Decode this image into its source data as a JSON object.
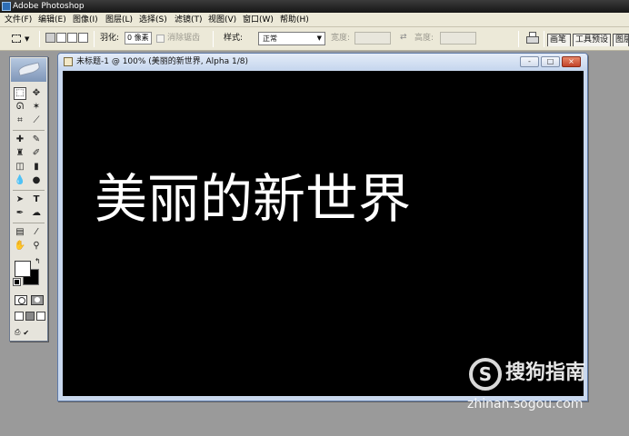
{
  "app": {
    "title": "Adobe Photoshop"
  },
  "menu": {
    "items": [
      "文件(F)",
      "编辑(E)",
      "图像(I)",
      "图层(L)",
      "选择(S)",
      "滤镜(T)",
      "视图(V)",
      "窗口(W)",
      "帮助(H)"
    ]
  },
  "options_bar": {
    "feather_label": "羽化:",
    "feather_value": "0 像素",
    "antialias_label": "消除锯齿",
    "style_label": "样式:",
    "style_value": "正常",
    "width_label": "宽度:",
    "height_label": "高度:",
    "well_tabs": [
      "画笔",
      "工具预设",
      "图层"
    ]
  },
  "document": {
    "title": "未标题-1 @ 100% (美丽的新世界, Alpha 1/8)",
    "canvas_text": "美丽的新世界",
    "buttons": {
      "minimize": "-",
      "maximize": "□",
      "close": "×"
    }
  },
  "watermark": {
    "logo": "S",
    "brand": "搜狗指南",
    "url": "zhinan.sogou.com"
  },
  "colors": {
    "foreground": "#ffffff",
    "background": "#000000",
    "canvas": "#000000"
  }
}
